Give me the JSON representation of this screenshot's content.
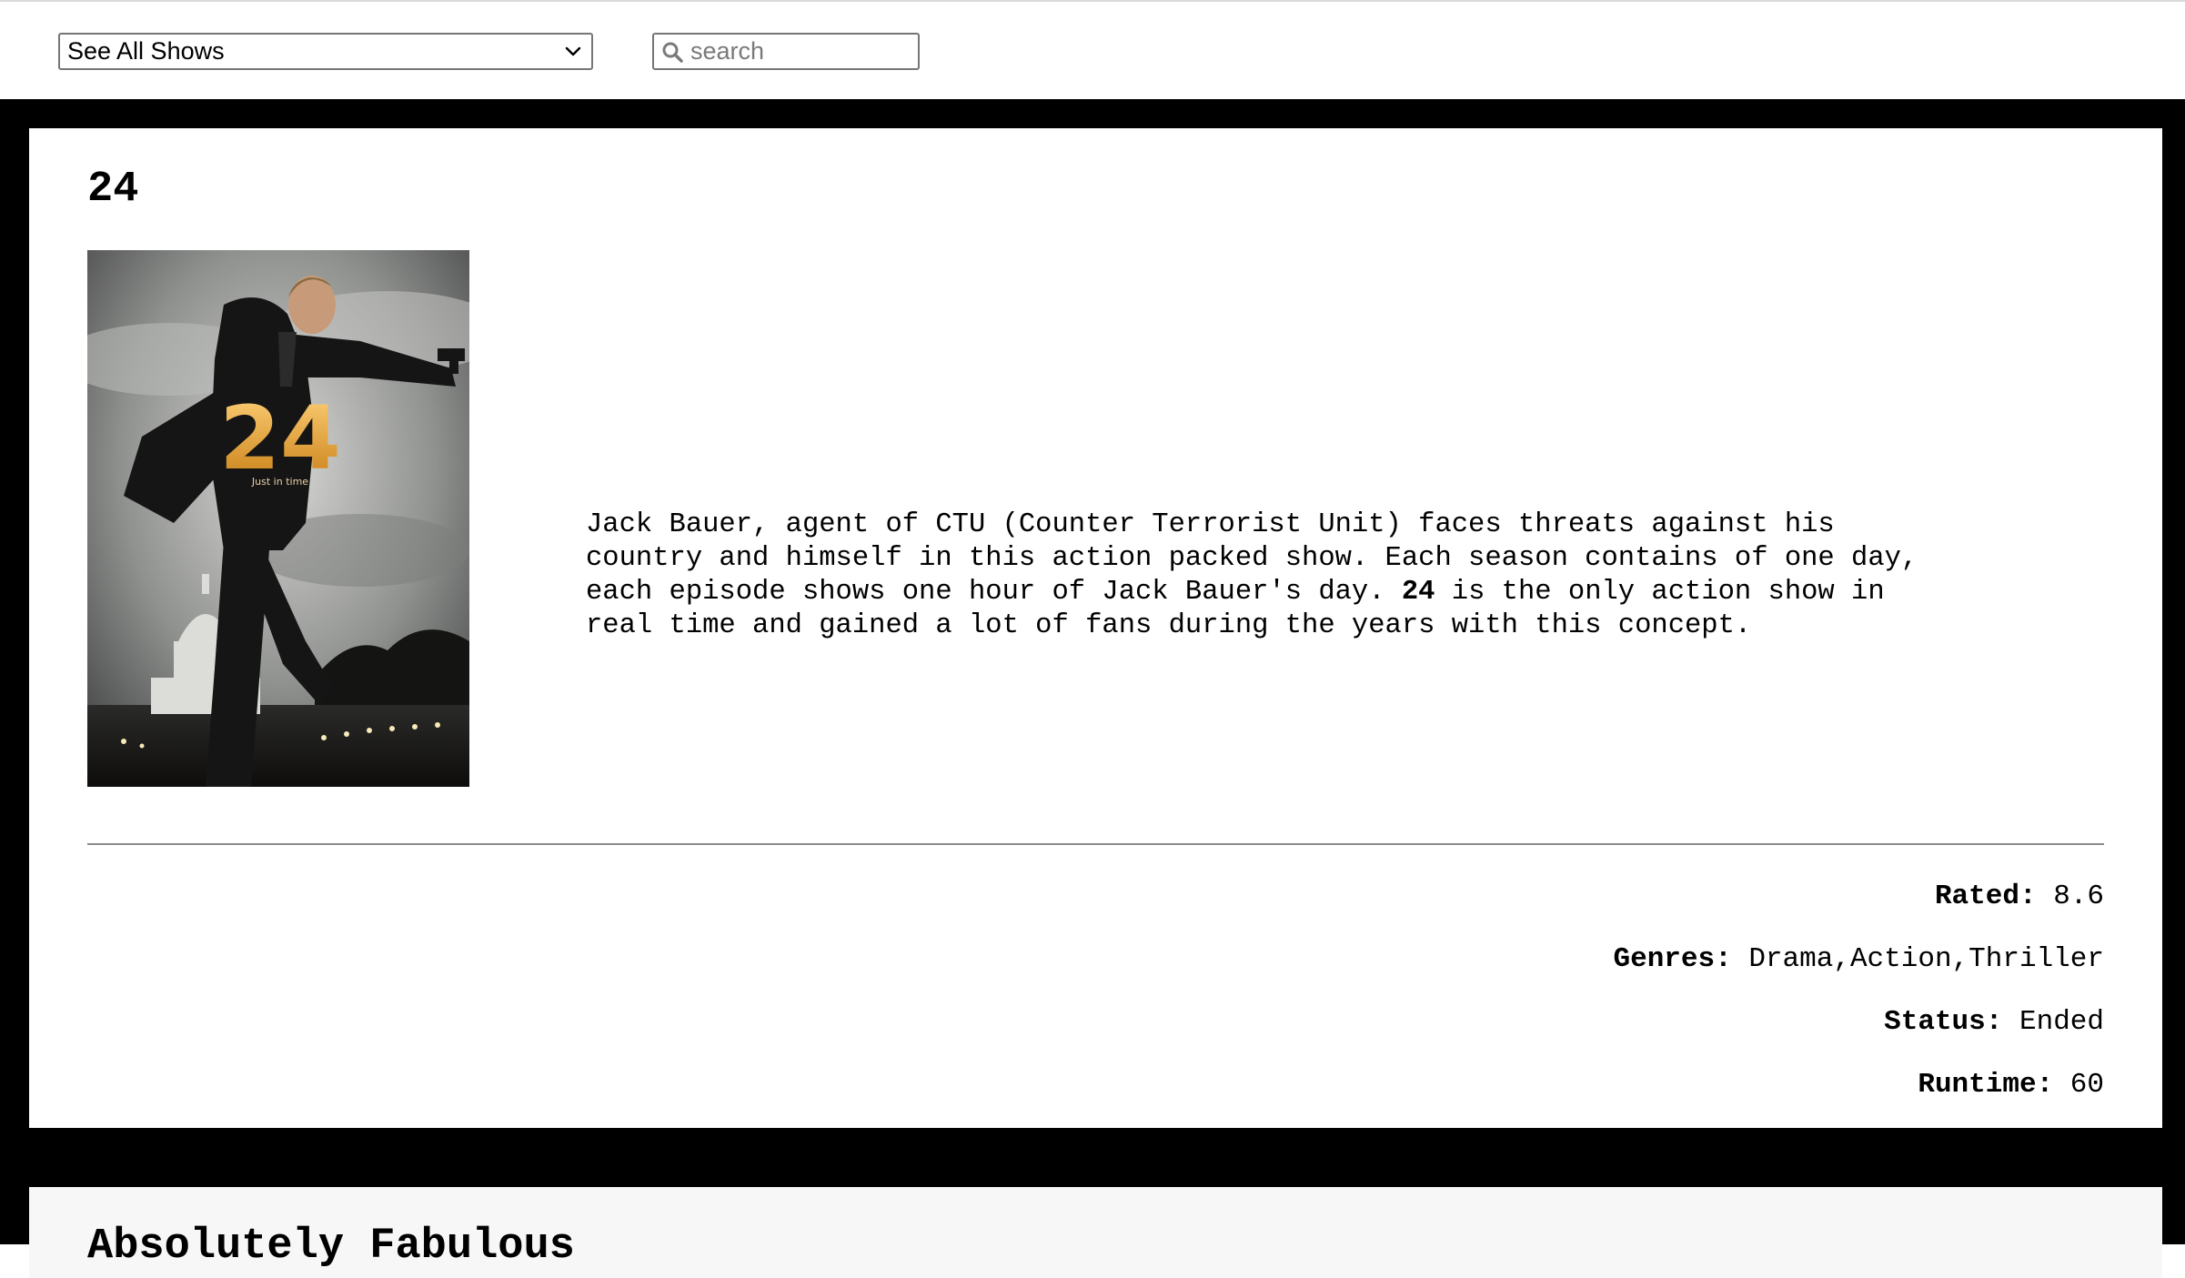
{
  "controls": {
    "show_select_value": "See All Shows",
    "search_placeholder": "search"
  },
  "shows": [
    {
      "title": "24",
      "poster_logo_text": "24",
      "poster_tagline": "Just in time",
      "description_before": "Jack Bauer, agent of CTU (Counter Terrorist Unit) faces threats against his\ncountry and himself in this action packed show. Each season contains of one day,\neach episode shows one hour of Jack Bauer's day. ",
      "description_bold": "24",
      "description_after": " is the only action show in\nreal time and gained a lot of fans during the years with this concept.",
      "meta": {
        "rated_label": "Rated:",
        "rated_value": "8.6",
        "genres_label": "Genres:",
        "genres_value": "Drama,Action,Thriller",
        "status_label": "Status:",
        "status_value": "Ended",
        "runtime_label": "Runtime:",
        "runtime_value": "60"
      }
    },
    {
      "title": "Absolutely Fabulous"
    }
  ]
}
